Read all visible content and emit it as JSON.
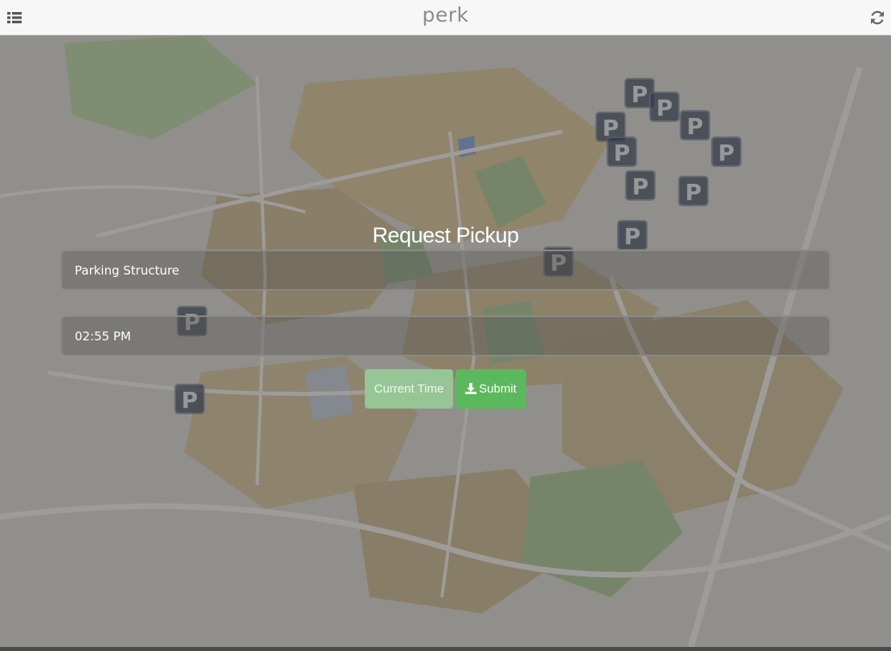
{
  "header": {
    "brand": "perk",
    "menu_icon": "list-icon",
    "refresh_icon": "refresh-icon"
  },
  "map": {
    "pin_label": "P",
    "pin_color": "#2b3850"
  },
  "form": {
    "title": "Request Pickup",
    "location_value": "Parking Structure",
    "time_value": "02:55 PM",
    "current_time_label": "Current Time",
    "submit_label": "Submit",
    "submit_icon": "download-icon"
  },
  "colors": {
    "submit": "#5cb85c",
    "current_time": "#97c595"
  }
}
